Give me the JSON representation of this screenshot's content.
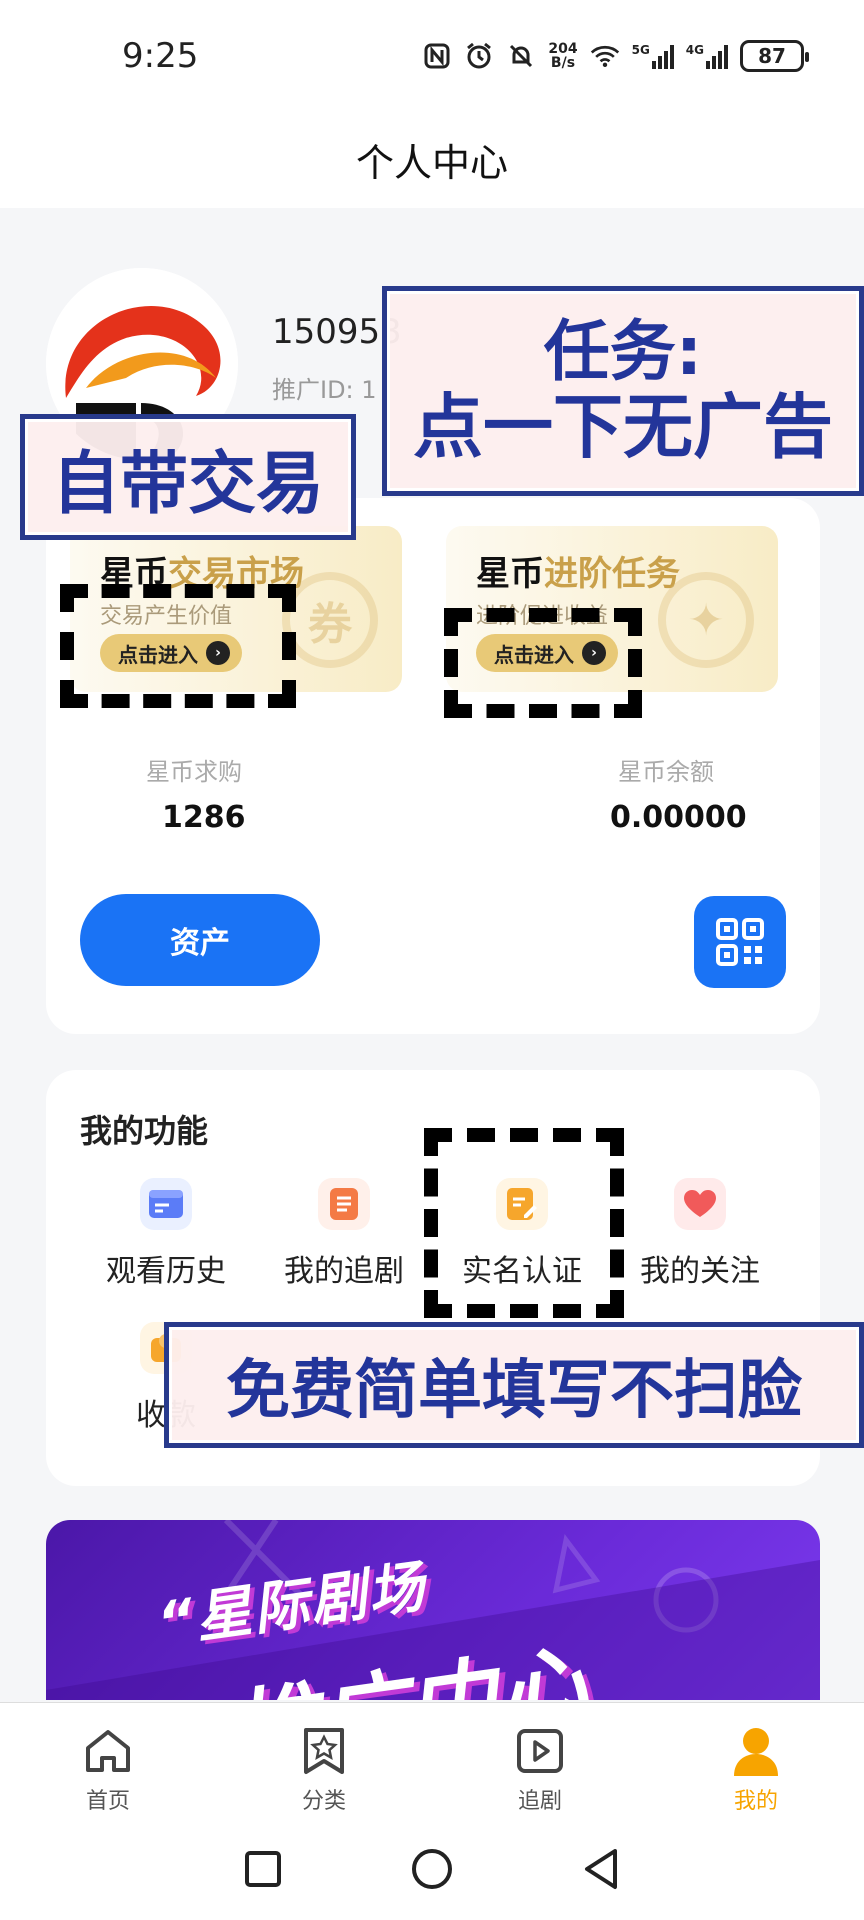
{
  "status": {
    "time": "9:25",
    "speed_top": "204",
    "speed_bottom": "B/s",
    "net1": "5G",
    "net2": "4G",
    "battery": "87"
  },
  "header": {
    "title": "个人中心"
  },
  "profile": {
    "phone": "150953",
    "promo_id": "推广ID: 1"
  },
  "entries": {
    "market": {
      "title_black": "星币",
      "title_gold": "交易市场",
      "subtitle": "交易产生价值",
      "button": "点击进入",
      "deco": "券"
    },
    "tasks": {
      "title_black": "星币",
      "title_gold": "进阶任务",
      "subtitle": "进阶促进收益",
      "button": "点击进入",
      "deco": "✦"
    }
  },
  "stats": {
    "buy_label": "星币求购",
    "buy_value": "1286",
    "balance_label": "星币余额",
    "balance_value": "0.00000"
  },
  "assets_button": "资产",
  "functions": {
    "title": "我的功能",
    "items": [
      {
        "label": "观看历史",
        "icon": "browser-history-icon",
        "color": "#5b7cf7"
      },
      {
        "label": "我的追剧",
        "icon": "document-list-icon",
        "color": "#f47a45"
      },
      {
        "label": "实名认证",
        "icon": "edit-document-icon",
        "color": "#f6a62c"
      },
      {
        "label": "我的关注",
        "icon": "heart-icon",
        "color": "#f15a5a"
      },
      {
        "label": "收款",
        "icon": "wallet-icon",
        "color": "#f6a62c"
      }
    ]
  },
  "banner": {
    "line1": "“星际剧场",
    "line2": "推广中心"
  },
  "tabs": [
    {
      "label": "首页",
      "icon": "home-icon"
    },
    {
      "label": "分类",
      "icon": "bookmark-star-icon"
    },
    {
      "label": "追剧",
      "icon": "play-icon"
    },
    {
      "label": "我的",
      "icon": "person-icon"
    }
  ],
  "annotations": {
    "task_line1": "任务:",
    "task_line2": "点一下无广告",
    "trade": "自带交易",
    "auth": "免费简单填写不扫脸"
  },
  "colors": {
    "primary": "#1a73f5",
    "gold": "#c9a04a",
    "active_tab": "#f7a400",
    "annotation_text": "#23359a"
  }
}
